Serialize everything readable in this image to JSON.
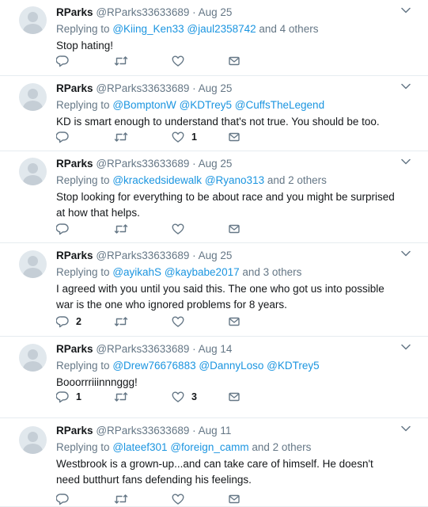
{
  "tweets": [
    {
      "name": "RParks",
      "handle": "@RParks33633689",
      "sep": " · ",
      "date": "Aug 25",
      "replying_prefix": "Replying to",
      "mentions": [
        "@Kiing_Ken33",
        "@jaul2358742"
      ],
      "mention_suffix": " and 4 others",
      "text": "Stop hating!",
      "reply_count": "",
      "retweet_count": "",
      "like_count": ""
    },
    {
      "name": "RParks",
      "handle": "@RParks33633689",
      "sep": " · ",
      "date": "Aug 25",
      "replying_prefix": "Replying to",
      "mentions": [
        "@BomptonW",
        "@KDTrey5",
        "@CuffsTheLegend"
      ],
      "mention_suffix": "",
      "text": "KD is smart enough to understand that's not true. You should be too.",
      "reply_count": "",
      "retweet_count": "",
      "like_count": "1"
    },
    {
      "name": "RParks",
      "handle": "@RParks33633689",
      "sep": " · ",
      "date": "Aug 25",
      "replying_prefix": "Replying to",
      "mentions": [
        "@krackedsidewalk",
        "@Ryano313"
      ],
      "mention_suffix": " and 2 others",
      "text": "Stop looking for everything to be about race and you might be surprised at how that helps.",
      "reply_count": "",
      "retweet_count": "",
      "like_count": ""
    },
    {
      "name": "RParks",
      "handle": "@RParks33633689",
      "sep": " · ",
      "date": "Aug 25",
      "replying_prefix": "Replying to",
      "mentions": [
        "@ayikahS",
        "@kaybabe2017"
      ],
      "mention_suffix": " and 3 others",
      "text": "I agreed with you until you said this. The one who got us into possible war is the one who ignored problems for 8 years.",
      "reply_count": "2",
      "retweet_count": "",
      "like_count": ""
    },
    {
      "name": "RParks",
      "handle": "@RParks33633689",
      "sep": " · ",
      "date": "Aug 14",
      "replying_prefix": "Replying to",
      "mentions": [
        "@Drew76676883",
        "@DannyLoso",
        "@KDTrey5"
      ],
      "mention_suffix": "",
      "text": "Booorrriiinnnggg!",
      "reply_count": "1",
      "retweet_count": "",
      "like_count": "3"
    },
    {
      "name": "RParks",
      "handle": "@RParks33633689",
      "sep": " · ",
      "date": "Aug 11",
      "replying_prefix": "Replying to",
      "mentions": [
        "@lateef301",
        "@foreign_camm"
      ],
      "mention_suffix": " and 2 others",
      "text": "Westbrook is a grown-up...and can take care of himself. He doesn't need butthurt fans defending his feelings.",
      "reply_count": "",
      "retweet_count": "",
      "like_count": ""
    }
  ]
}
